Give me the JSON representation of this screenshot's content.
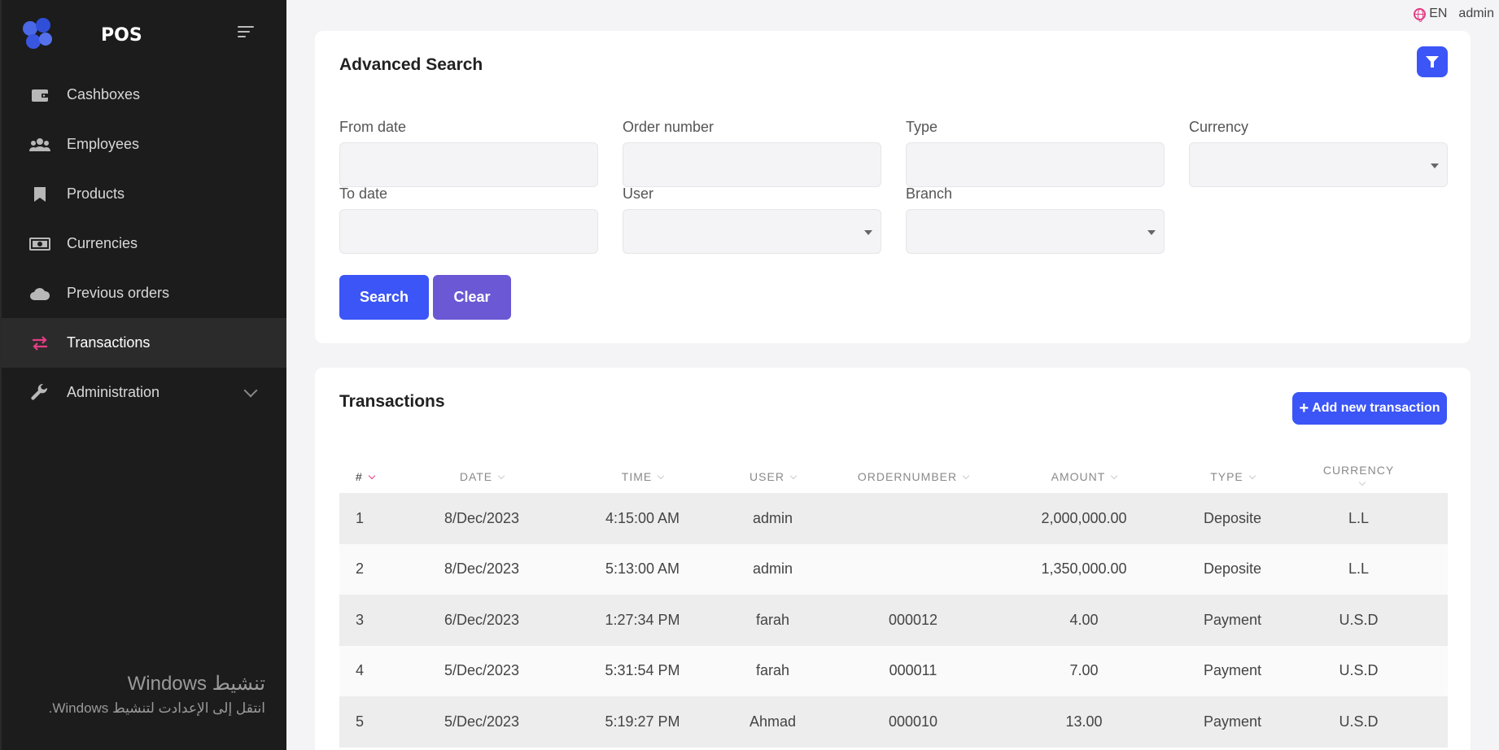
{
  "app": {
    "name": "POS"
  },
  "topbar": {
    "language": "EN",
    "user": "admin"
  },
  "sidebar": {
    "items": [
      {
        "label": "Cashboxes",
        "icon": "wallet-icon"
      },
      {
        "label": "Employees",
        "icon": "users-icon"
      },
      {
        "label": "Products",
        "icon": "bookmark-icon"
      },
      {
        "label": "Currencies",
        "icon": "money-bill-icon"
      },
      {
        "label": "Previous orders",
        "icon": "cloud-icon"
      },
      {
        "label": "Transactions",
        "icon": "exchange-icon",
        "active": true
      },
      {
        "label": "Administration",
        "icon": "wrench-icon",
        "expandable": true
      }
    ]
  },
  "watermark": {
    "line1": "تنشيط Windows",
    "line2": "انتقل إلى الإعدادت لتنشيط Windows."
  },
  "search": {
    "title": "Advanced Search",
    "fields": {
      "from_date": "From date",
      "order_number": "Order number",
      "type": "Type",
      "currency": "Currency",
      "to_date": "To date",
      "user": "User",
      "branch": "Branch"
    },
    "search_label": "Search",
    "clear_label": "Clear"
  },
  "transactions": {
    "title": "Transactions",
    "add_label": "Add new transaction",
    "columns": [
      "#",
      "DATE",
      "TIME",
      "USER",
      "ORDERNUMBER",
      "AMOUNT",
      "TYPE",
      "CURRENCY"
    ],
    "rows": [
      [
        "1",
        "8/Dec/2023",
        "4:15:00 AM",
        "admin",
        "",
        "2,000,000.00",
        "Deposite",
        "L.L"
      ],
      [
        "2",
        "8/Dec/2023",
        "5:13:00 AM",
        "admin",
        "",
        "1,350,000.00",
        "Deposite",
        "L.L"
      ],
      [
        "3",
        "6/Dec/2023",
        "1:27:34 PM",
        "farah",
        "000012",
        "4.00",
        "Payment",
        "U.S.D"
      ],
      [
        "4",
        "5/Dec/2023",
        "5:31:54 PM",
        "farah",
        "000011",
        "7.00",
        "Payment",
        "U.S.D"
      ],
      [
        "5",
        "5/Dec/2023",
        "5:19:27 PM",
        "Ahmad",
        "000010",
        "13.00",
        "Payment",
        "U.S.D"
      ]
    ]
  },
  "colors": {
    "primary": "#3b55f6",
    "secondary": "#6a58d4",
    "accent": "#e33d84",
    "sidebar": "#1c1c1c"
  }
}
